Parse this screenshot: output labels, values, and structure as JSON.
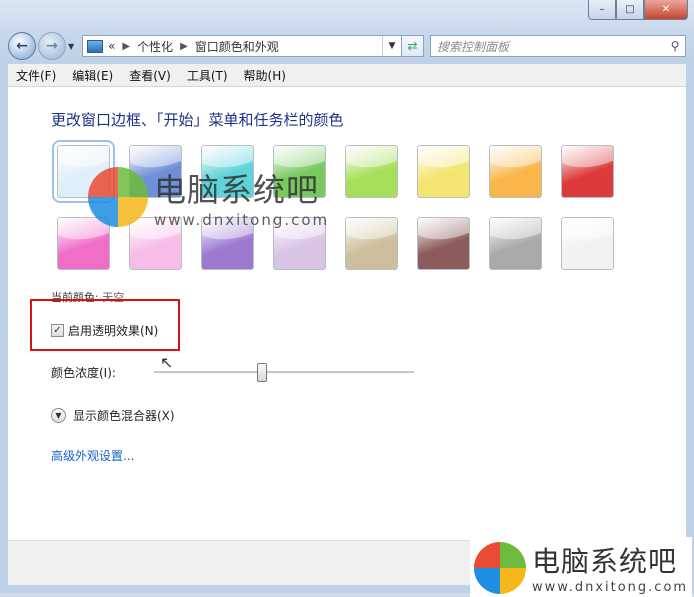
{
  "window": {
    "caption_buttons": {
      "minimize": "–",
      "maximize": "□",
      "close": "✕"
    }
  },
  "nav": {
    "back_icon": "arrow-left-icon",
    "forward_icon": "arrow-right-icon",
    "breadcrumb_prefix": "«",
    "breadcrumb": [
      "个性化",
      "窗口颜色和外观"
    ],
    "search_placeholder": "搜索控制面板"
  },
  "menu": [
    "文件(F)",
    "编辑(E)",
    "查看(V)",
    "工具(T)",
    "帮助(H)"
  ],
  "content": {
    "heading": "更改窗口边框、「开始」菜单和任务栏的颜色",
    "swatches_row1": [
      "#dfeefa",
      "#6f8fd6",
      "#5fd3da",
      "#79c860",
      "#a6df5a",
      "#f4e472",
      "#f8b64a",
      "#dc3b3b"
    ],
    "swatches_row2": [
      "#f06ec8",
      "#f7bde8",
      "#9d7ad0",
      "#d9c4e6",
      "#cdbf9e",
      "#8c5b5b",
      "#a9a9a9",
      "#f2f2f2"
    ],
    "current_color_label": "当前颜色:",
    "current_color_value": "天空",
    "transparency_label": "启用透明效果(N)",
    "transparency_checked": true,
    "intensity_label": "颜色浓度(I):",
    "intensity_value": 0.4,
    "mixer_label": "显示颜色混合器(X)",
    "advanced_link": "高级外观设置..."
  },
  "watermark": {
    "text": "电脑系统吧",
    "url": "www.dnxitong.com"
  },
  "colors": {
    "heading": "#1e3287",
    "link": "#1660c9",
    "highlight_box": "#d21414"
  }
}
